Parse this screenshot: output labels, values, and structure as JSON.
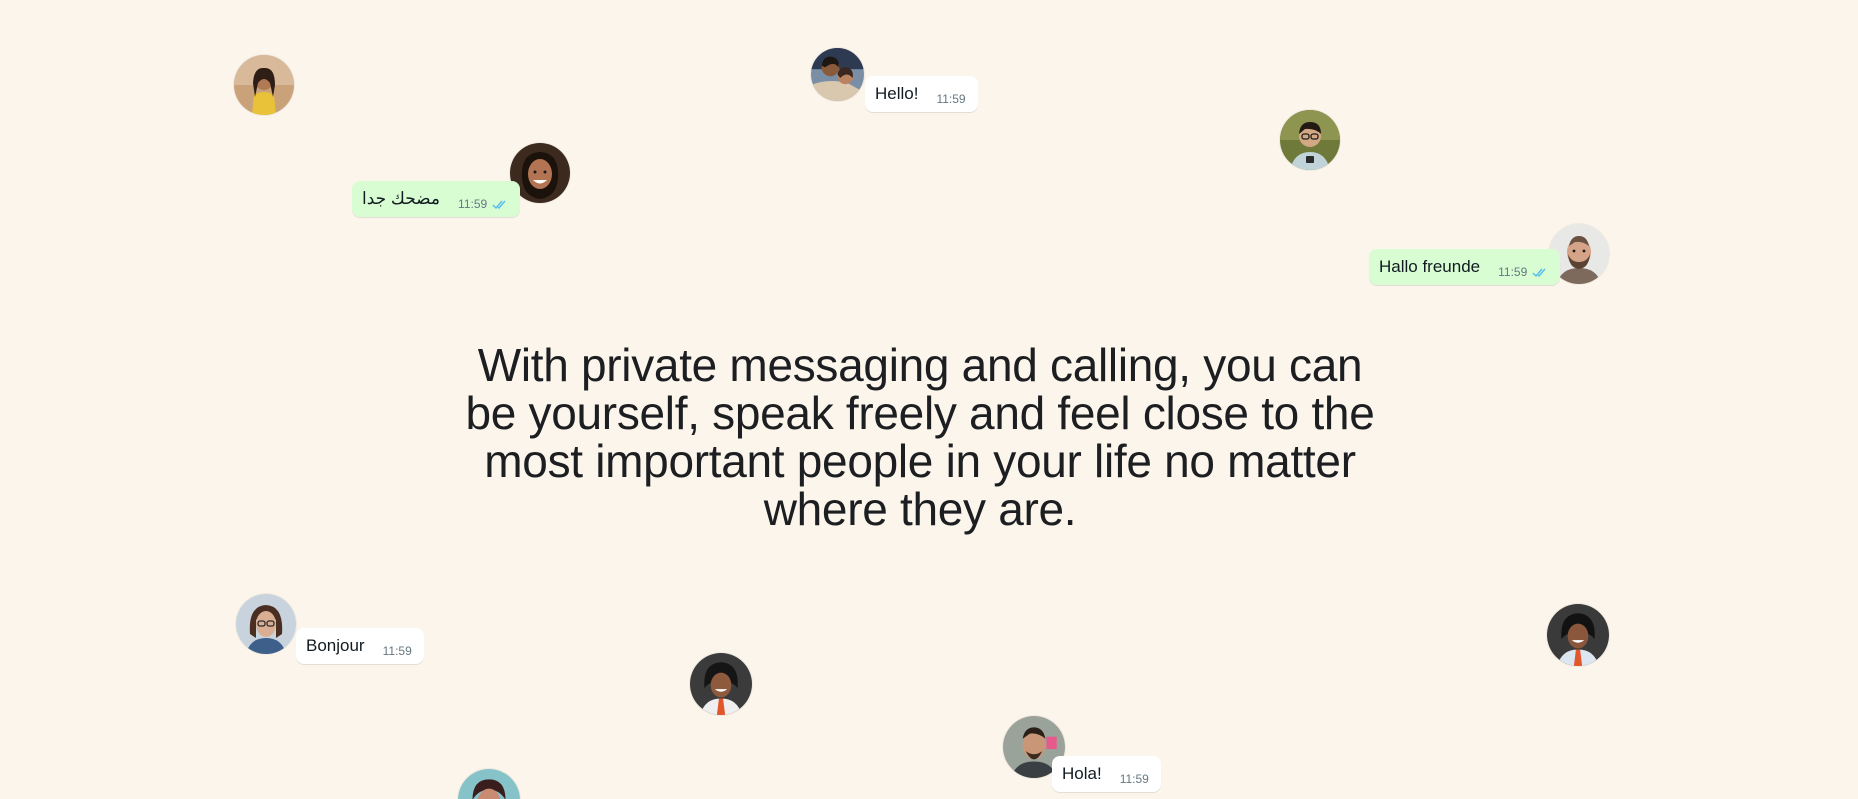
{
  "headline": {
    "text": "With private messaging and calling, you can be yourself, speak freely and feel close to the most important people in your life no matter where they are."
  },
  "colors": {
    "background": "#FCF5EB",
    "incoming_bubble": "#FFFFFF",
    "outgoing_bubble": "#D9FDD3",
    "read_ticks": "#53BDEB",
    "timestamp": "#667781",
    "text": "#1C1E21"
  },
  "bubbles": {
    "arabic": {
      "text": "مضحك جدا",
      "time": "11:59",
      "status_icon": "double-check-read-icon"
    },
    "hello": {
      "text": "Hello!",
      "time": "11:59"
    },
    "hallo": {
      "text": "Hallo freunde",
      "time": "11:59",
      "status_icon": "double-check-read-icon"
    },
    "bonjour": {
      "text": "Bonjour",
      "time": "11:59"
    },
    "hola": {
      "text": "Hola!",
      "time": "11:59"
    }
  }
}
